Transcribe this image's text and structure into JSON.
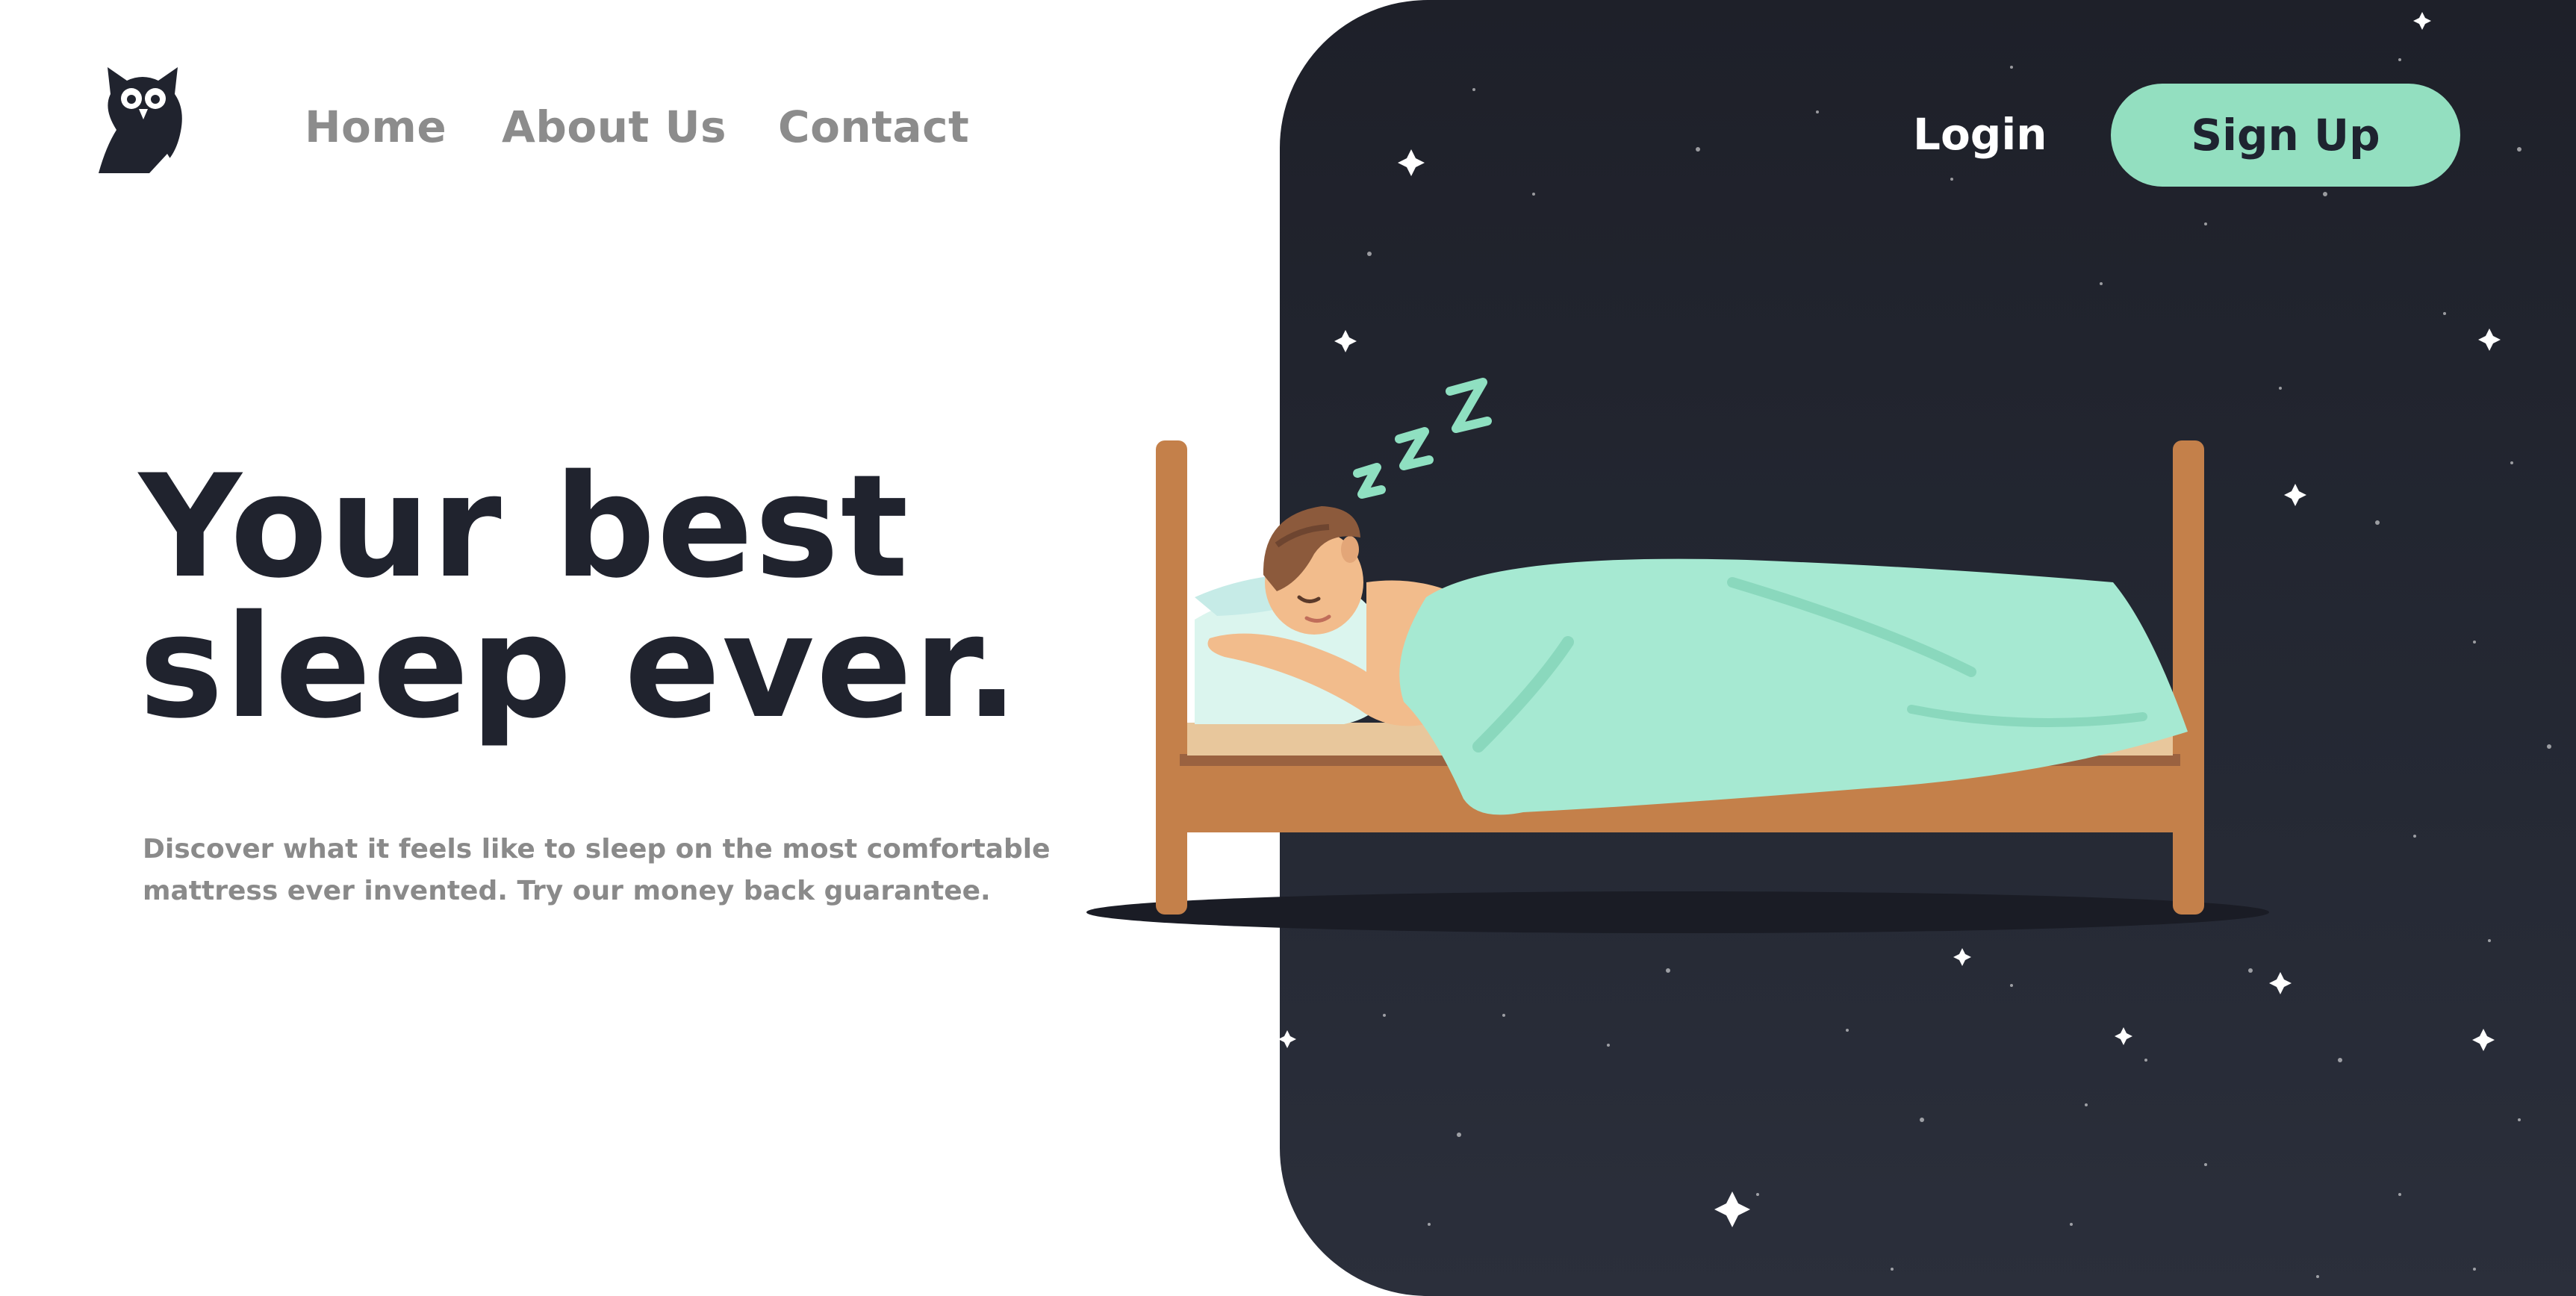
{
  "logo": {
    "icon": "owl-logo-icon"
  },
  "nav": {
    "items": [
      {
        "label": "Home"
      },
      {
        "label": "About Us"
      },
      {
        "label": "Contact"
      }
    ]
  },
  "auth": {
    "login_label": "Login",
    "signup_label": "Sign Up"
  },
  "hero": {
    "title_line1": "Your best",
    "title_line2": "sleep ever.",
    "description_line1": "Discover what it feels like to sleep on the most comfortable",
    "description_line2": "mattress ever invented. Try our money back guarantee."
  },
  "illustration": {
    "icon": "sleeping-man-in-bed-illustration",
    "snore_icon": "zzz-snore-icon",
    "background": "starry-night-sky"
  },
  "colors": {
    "accent": "#93dfc0",
    "dark_text": "#20232e",
    "muted_text": "#8a8a8a",
    "night_sky": "#22252f",
    "bed_wood": "#c4804a",
    "blanket": "#a6e9d2"
  }
}
